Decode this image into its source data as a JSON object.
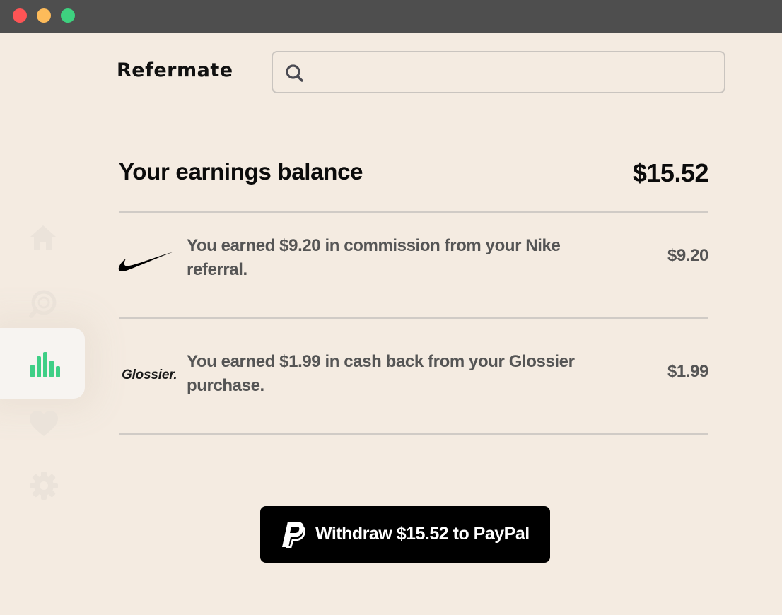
{
  "window": {
    "controls": [
      "close",
      "minimize",
      "zoom"
    ],
    "colors": {
      "close": "#fe5455",
      "minimize": "#fdbb5a",
      "zoom": "#3ed17f"
    }
  },
  "header": {
    "brand": "Refermate",
    "search": {
      "placeholder": "",
      "value": "",
      "icon": "search-icon"
    }
  },
  "sidebar": {
    "items": [
      {
        "name": "home",
        "icon": "home-icon",
        "active": false
      },
      {
        "name": "deals",
        "icon": "coin-search-icon",
        "active": false
      },
      {
        "name": "earnings",
        "icon": "bar-chart-icon",
        "active": true
      },
      {
        "name": "favorites",
        "icon": "heart-icon",
        "active": false
      },
      {
        "name": "settings",
        "icon": "gear-icon",
        "active": false
      }
    ],
    "active_color": "#3fcf86"
  },
  "balance": {
    "label": "Your earnings balance",
    "amount": "$15.52"
  },
  "transactions": [
    {
      "brand": "Nike",
      "logo": "nike-swoosh-icon",
      "description": "You earned $9.20 in commission from your Nike referral.",
      "amount": "$9.20"
    },
    {
      "brand": "Glossier",
      "logo_text": "Glossier.",
      "description": "You earned $1.99 in cash back from your Glossier purchase.",
      "amount": "$1.99"
    }
  ],
  "withdraw": {
    "label": "Withdraw $15.52 to PayPal",
    "icon": "paypal-icon"
  }
}
